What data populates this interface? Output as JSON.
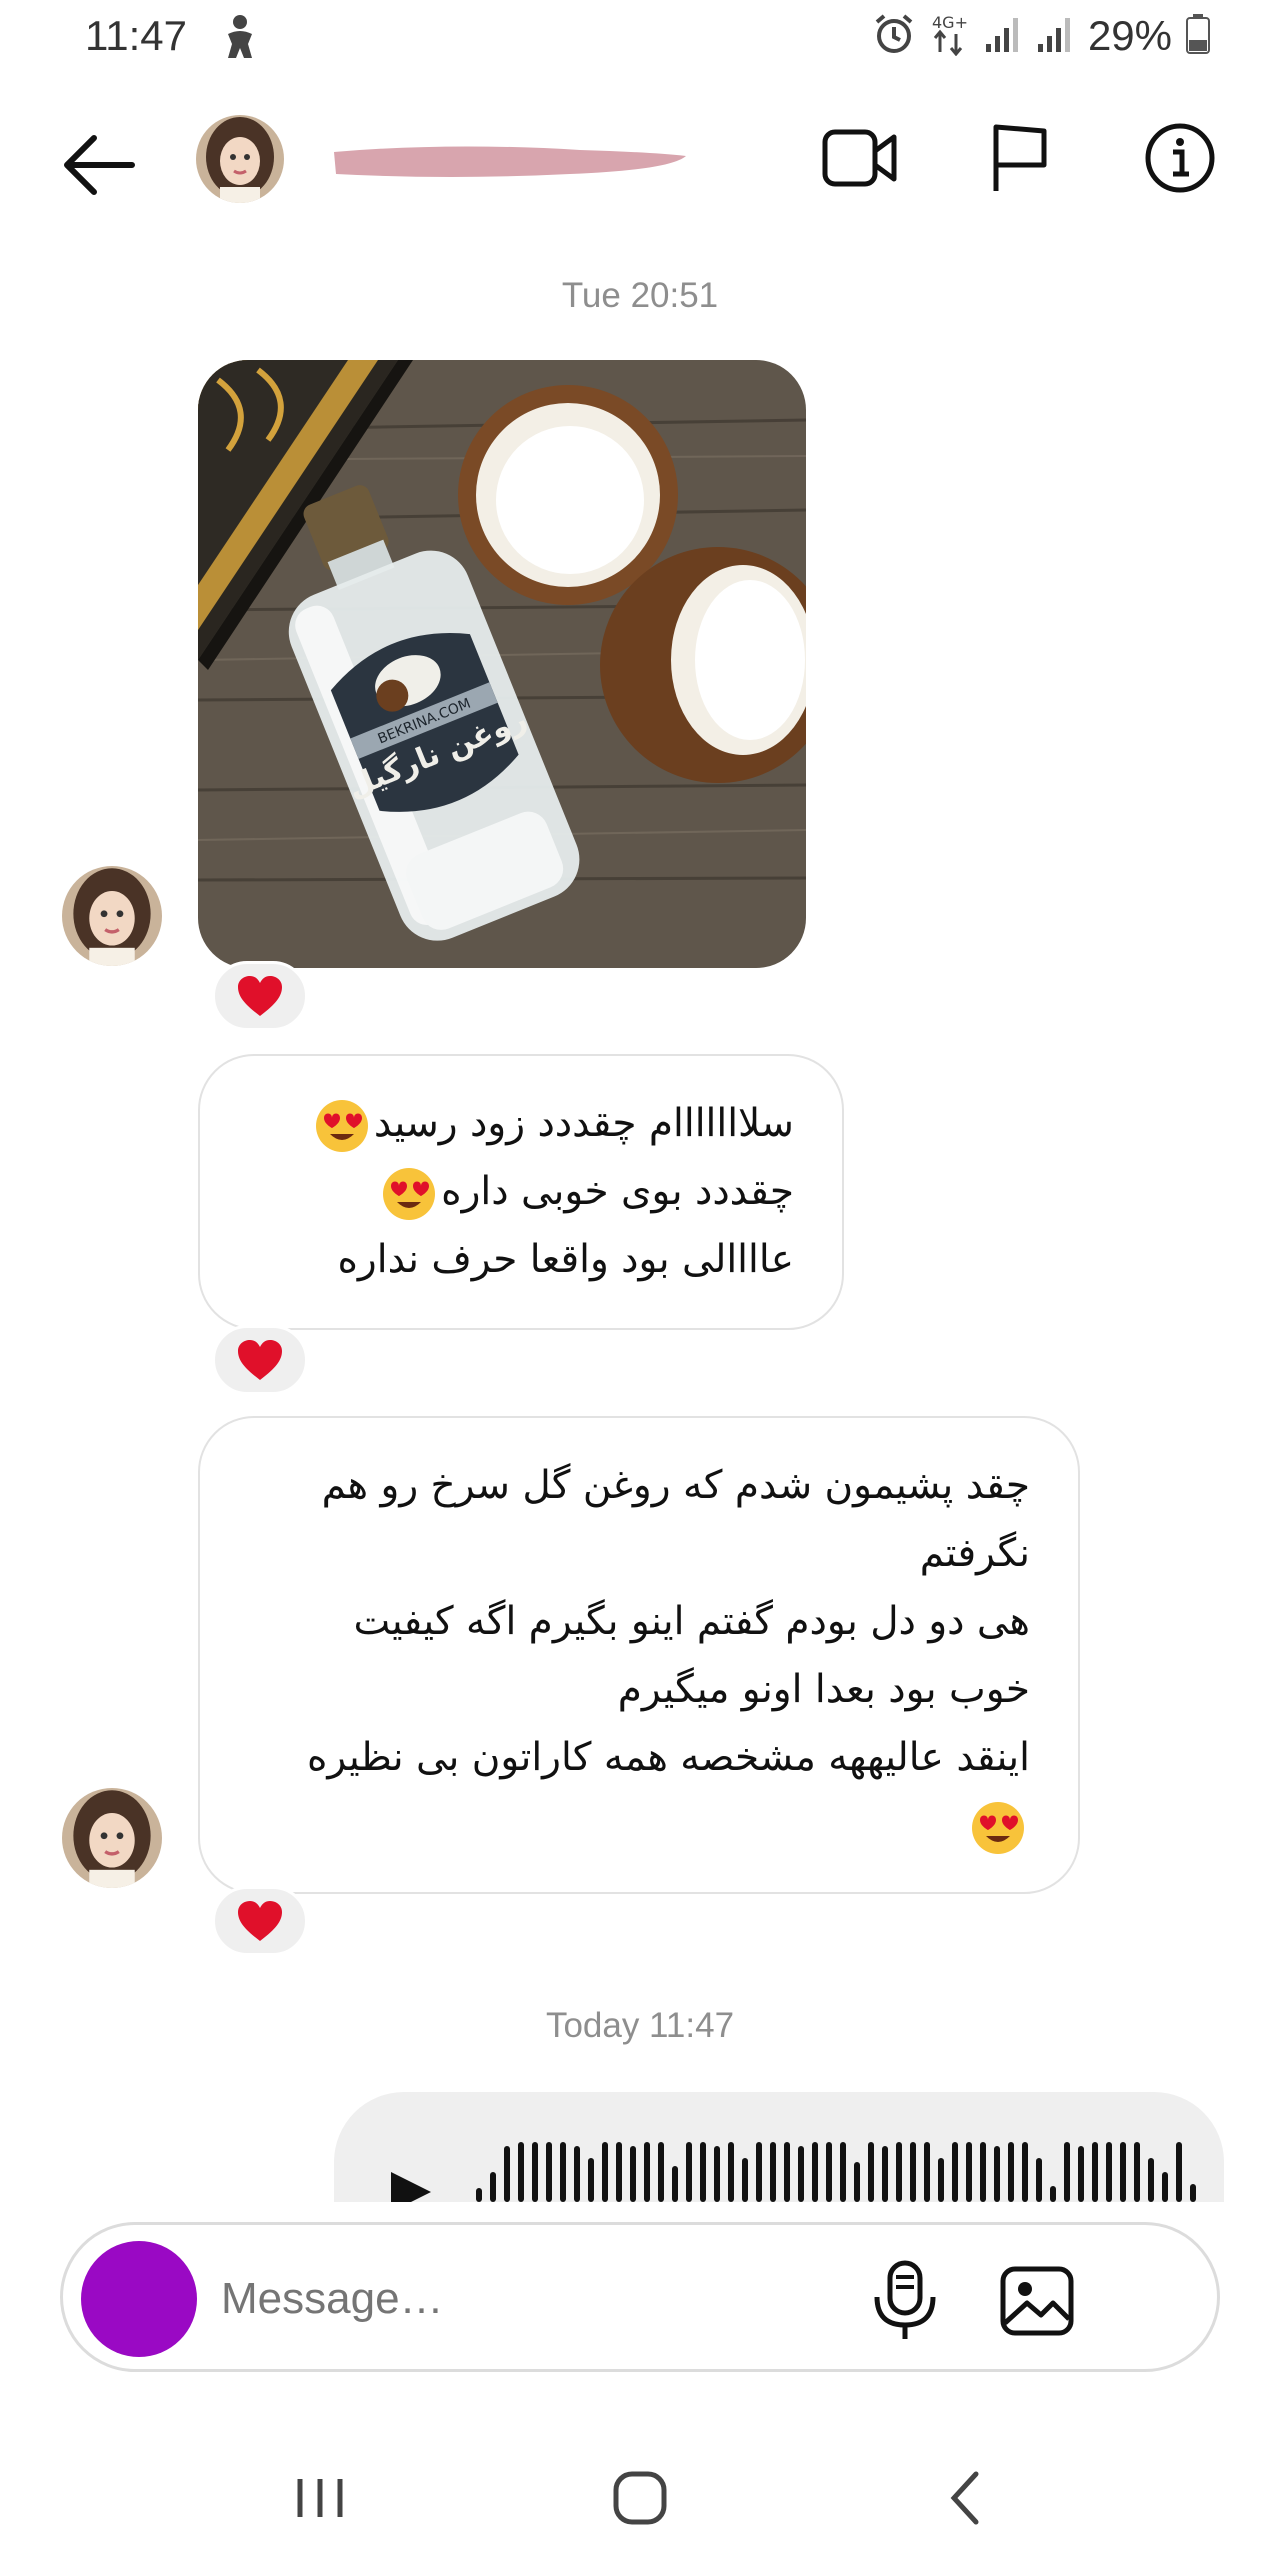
{
  "status_bar": {
    "time": "11:47",
    "network": "4G+",
    "battery": "29%"
  },
  "header": {
    "contact_name_redacted": true,
    "icons": [
      "back-arrow-icon",
      "video-call-icon",
      "flag-icon",
      "info-icon"
    ]
  },
  "chat": {
    "timestamp_1": "Tue 20:51",
    "image_message": {
      "brand_label": "BEKRINA.COM",
      "product_label": "روغن نارگیل"
    },
    "message_1": {
      "lines": [
        "سلااااااام چقددد زود رسید",
        "چقددد بوی خوبی داره",
        "عاااالی بود واقعا حرف نداره"
      ]
    },
    "message_2": {
      "lines": [
        "چقد پشیمون شدم که روغن گل سرخ رو هم",
        "نگرفتم",
        "هی دو دل بودم گفتم اینو بگیرم اگه کیفیت",
        "خوب بود بعدا اونو میگیرم",
        "اینقد عالیههه مشخصه همه کاراتون بی نظیره",
        ""
      ]
    },
    "reaction": "heart",
    "timestamp_2": "Today 11:47"
  },
  "composer": {
    "placeholder": "Message…"
  },
  "colors": {
    "heart": "#e0102a",
    "composer_avatar": "#9a09c4",
    "timestamp": "#8e8e8e",
    "reaction_bg": "#efefef"
  }
}
